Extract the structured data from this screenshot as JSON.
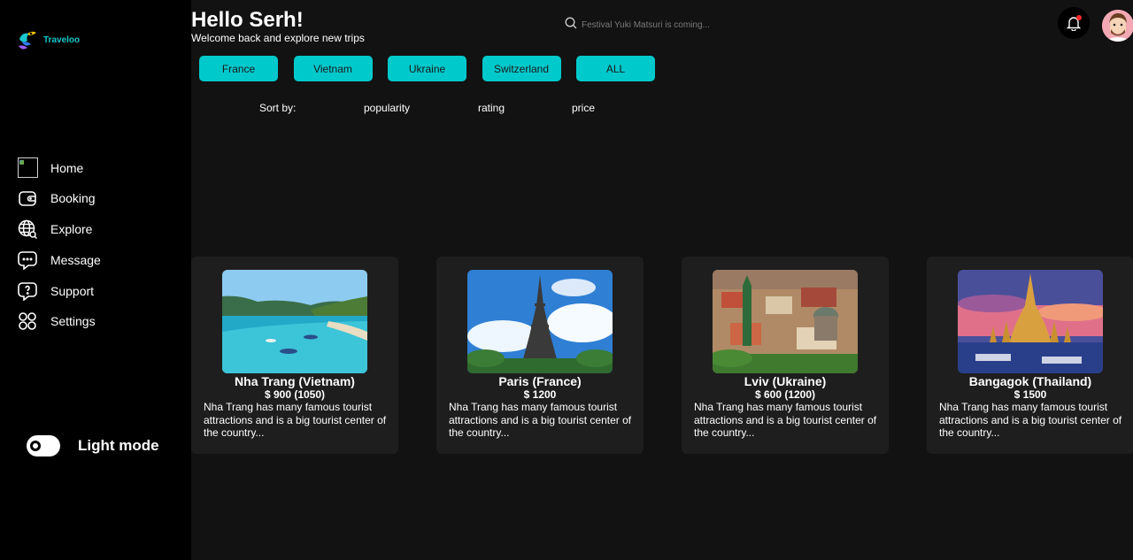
{
  "brand": {
    "name": "Traveloo"
  },
  "header": {
    "greeting": "Hello Serh!",
    "subtitle": "Welcome back and explore new trips",
    "search_placeholder": "Festival Yuki Matsuri is coming..."
  },
  "sidebar": {
    "items": [
      {
        "label": "Home",
        "icon": "home-image-icon"
      },
      {
        "label": "Booking",
        "icon": "wallet-icon"
      },
      {
        "label": "Explore",
        "icon": "globe-search-icon"
      },
      {
        "label": "Message",
        "icon": "chat-icon"
      },
      {
        "label": "Support",
        "icon": "help-chat-icon"
      },
      {
        "label": "Settings",
        "icon": "grid-icon"
      }
    ],
    "mode_label": "Light mode"
  },
  "filters": [
    "France",
    "Vietnam",
    "Ukraine",
    "Switzerland",
    "ALL"
  ],
  "sort": {
    "label": "Sort by:",
    "options": [
      "popularity",
      "rating",
      "price"
    ]
  },
  "trips": [
    {
      "title": "Nha Trang (Vietnam)",
      "price": "$ 900 (1050)",
      "description": "Nha Trang has many famous tourist attractions and is a big tourist center of the country..."
    },
    {
      "title": "Paris (France)",
      "price": "$ 1200",
      "description": "Nha Trang has many famous tourist attractions and is a big tourist center of the country..."
    },
    {
      "title": "Lviv (Ukraine)",
      "price": "$ 600 (1200)",
      "description": "Nha Trang has many famous tourist attractions and is a big tourist center of the country..."
    },
    {
      "title": "Bangagok (Thailand)",
      "price": "$ 1500",
      "description": "Nha Trang has many famous tourist attractions and is a big tourist center of the country..."
    }
  ],
  "colors": {
    "accent": "#00c9cc",
    "background": "#121212",
    "sidebar": "#000000",
    "card": "#1e1e1e",
    "notification": "#ff2b2b"
  }
}
